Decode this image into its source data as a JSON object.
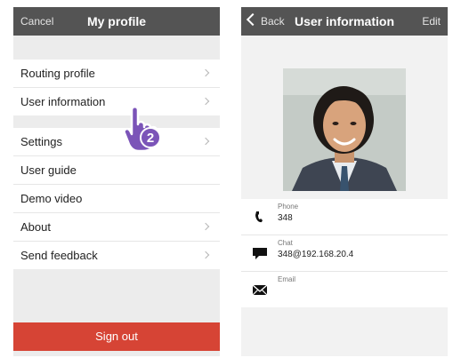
{
  "left": {
    "nav": {
      "cancel": "Cancel",
      "title": "My profile"
    },
    "group1": [
      "Routing profile",
      "User information"
    ],
    "group2": [
      "Settings",
      "User guide",
      "Demo video",
      "About",
      "Send feedback"
    ],
    "hand_badge": "2",
    "signout": "Sign out"
  },
  "right": {
    "nav": {
      "back": "Back",
      "title": "User information",
      "edit": "Edit"
    },
    "fields": [
      {
        "label": "Phone",
        "value": "348",
        "icon": "phone-icon"
      },
      {
        "label": "Chat",
        "value": "348@192.168.20.4",
        "icon": "chat-icon"
      },
      {
        "label": "Email",
        "value": "",
        "icon": "email-icon"
      }
    ]
  },
  "colors": {
    "navbar": "#545454",
    "signout": "#d64435",
    "hand": "#7b54b8"
  }
}
